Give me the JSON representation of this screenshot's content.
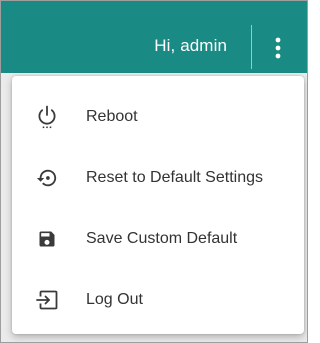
{
  "header": {
    "greeting": "Hi, admin",
    "more_icon": "more-vert-icon",
    "background_color": "#1a8a84"
  },
  "menu": {
    "items": [
      {
        "label": "Reboot",
        "icon": "power-icon"
      },
      {
        "label": "Reset to Default Settings",
        "icon": "restore-icon"
      },
      {
        "label": "Save Custom Default",
        "icon": "save-icon"
      },
      {
        "label": "Log Out",
        "icon": "logout-icon"
      }
    ]
  }
}
